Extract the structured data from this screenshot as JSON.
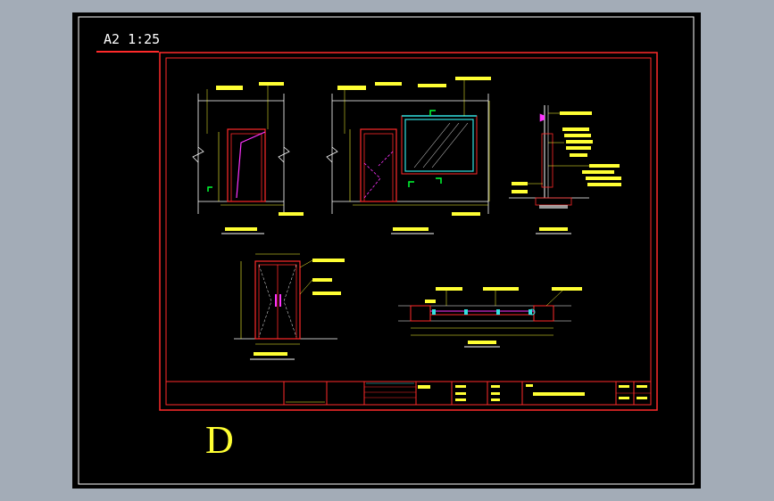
{
  "sheet": {
    "scale_label": "A2 1:25",
    "sheet_mark": "D"
  },
  "colors": {
    "background": "#a3acb7",
    "sheet": "#000000",
    "frame": "#ff2a2a",
    "annotation": "#ffff33",
    "glass": "#33e0e0",
    "accent": "#ff33ff",
    "border": "#ffffff"
  },
  "views": [
    {
      "name": "elevation-single-door"
    },
    {
      "name": "elevation-glass-partition"
    },
    {
      "name": "section-2-2"
    },
    {
      "name": "elevation-double-door"
    },
    {
      "name": "section-1-1"
    }
  ]
}
